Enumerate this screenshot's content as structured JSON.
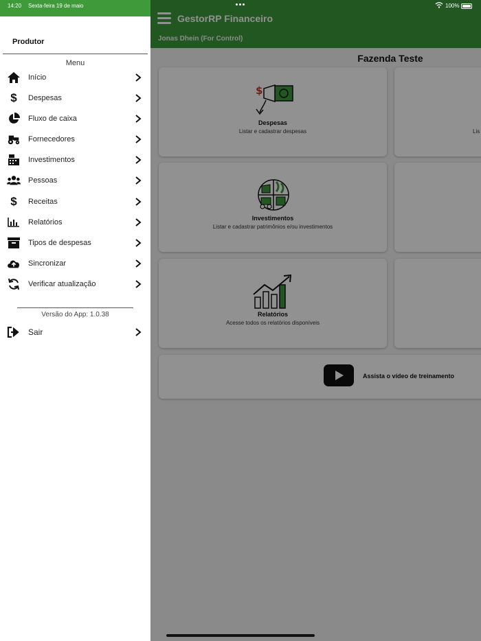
{
  "statusbar": {
    "time": "14:20",
    "date": "Sexta-feira 19 de maio",
    "battery": "100%"
  },
  "app": {
    "title": "GestorRP Financeiro",
    "user": "Jonas Dhein (For Control)",
    "farm": "Fazenda Teste",
    "cards": [
      {
        "title": "Despesas",
        "subtitle": "Listar e cadastrar despesas",
        "icon": "expense-icon"
      },
      {
        "title": "Investimentos",
        "subtitle": "Listar e cadastrar patrimônios e/ou investimentos",
        "icon": "investment-icon"
      },
      {
        "title": "Relatórios",
        "subtitle": "Acesse todos os relatórios disponíveis",
        "icon": "chart-growth-icon"
      }
    ],
    "right_card_partial_text": "Lis",
    "video_label": "Assista o vídeo de treinamento"
  },
  "drawer": {
    "producer_label": "Produtor",
    "menu_heading": "Menu",
    "items": [
      {
        "label": "Início",
        "icon": "home-icon"
      },
      {
        "label": "Despesas",
        "icon": "dollar-icon"
      },
      {
        "label": "Fluxo de caixa",
        "icon": "pie-chart-icon"
      },
      {
        "label": "Fornecedores",
        "icon": "tractor-icon"
      },
      {
        "label": "Investimentos",
        "icon": "cash-register-icon"
      },
      {
        "label": "Pessoas",
        "icon": "users-icon"
      },
      {
        "label": "Receitas",
        "icon": "dollar-icon"
      },
      {
        "label": "Relatórios",
        "icon": "bar-chart-icon"
      },
      {
        "label": "Tipos de despesas",
        "icon": "archive-box-icon"
      },
      {
        "label": "Sincronizar",
        "icon": "cloud-upload-icon"
      },
      {
        "label": "Verificar atualização",
        "icon": "refresh-icon"
      }
    ],
    "version": "Versão do App: 1.0.38",
    "logout_label": "Sair"
  },
  "colors": {
    "brand_green": "#3f9a3a",
    "overlay": "rgba(0,0,0,0.43)"
  }
}
